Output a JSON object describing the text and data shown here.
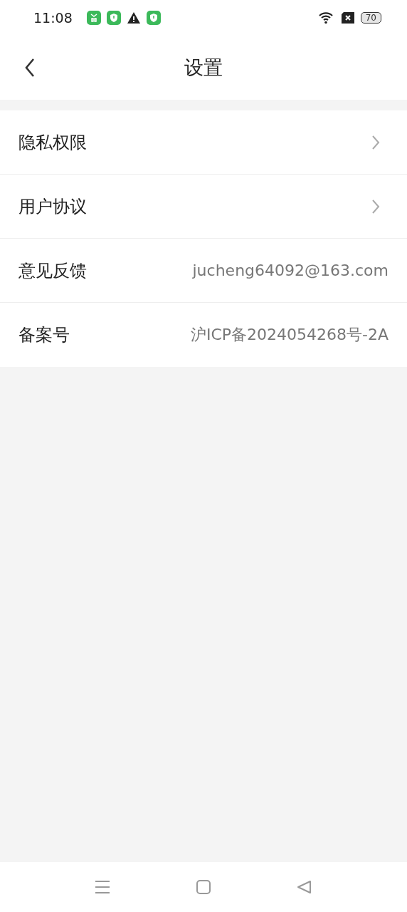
{
  "status_bar": {
    "time": "11:08",
    "battery": "70"
  },
  "header": {
    "title": "设置"
  },
  "settings": [
    {
      "kind": "link",
      "label": "隐私权限"
    },
    {
      "kind": "link",
      "label": "用户协议"
    },
    {
      "kind": "value",
      "label": "意见反馈",
      "value": "jucheng64092@163.com"
    },
    {
      "kind": "value",
      "label": "备案号",
      "value": "沪ICP备2024054268号-2A"
    }
  ]
}
